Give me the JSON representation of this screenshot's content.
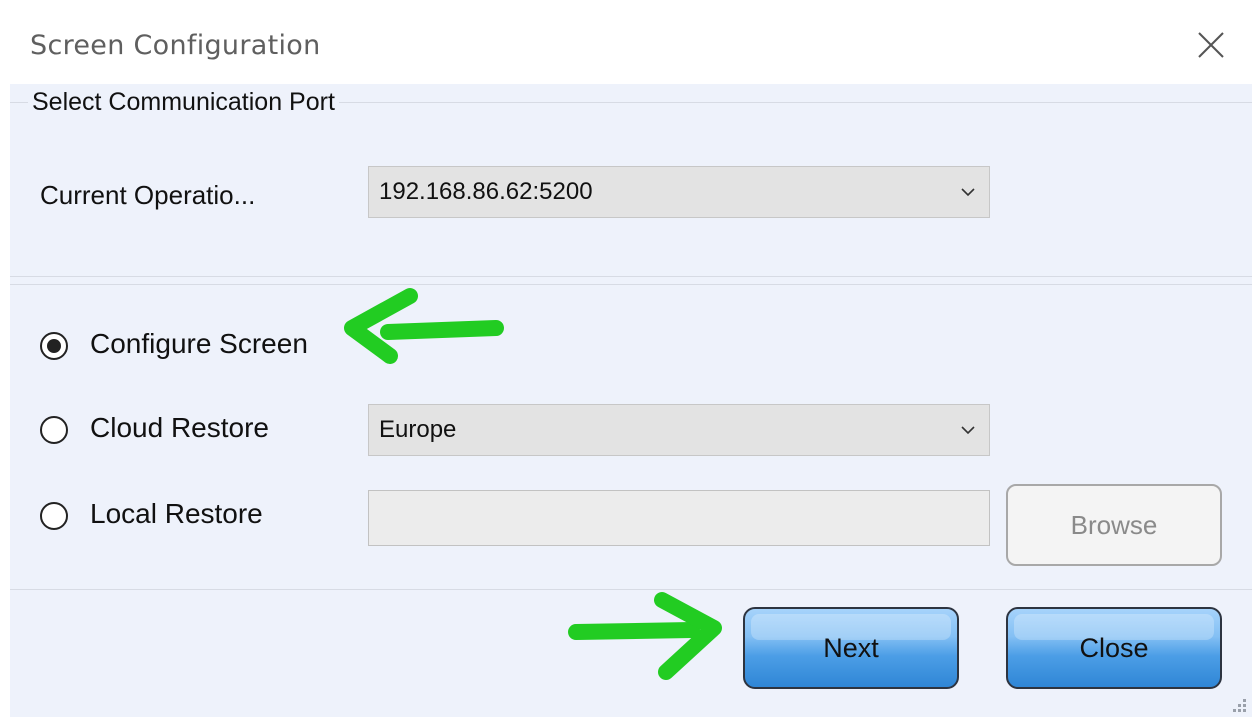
{
  "window": {
    "title": "Screen Configuration",
    "close_icon": "close-icon"
  },
  "port_group": {
    "legend": "Select Communication Port",
    "current_label": "Current Operatio...",
    "current_value": "192.168.86.62:5200"
  },
  "options": {
    "configure_label": "Configure Screen",
    "cloud_label": "Cloud Restore",
    "cloud_region": "Europe",
    "local_label": "Local Restore",
    "local_path": "",
    "browse_label": "Browse",
    "selected": "configure"
  },
  "footer": {
    "next_label": "Next",
    "close_label": "Close"
  },
  "annotations": {
    "arrow_color": "#22cc22",
    "arrow_icon": "green-arrow-icon"
  },
  "colors": {
    "client_bg": "#eef2fb",
    "primary_button": "#4c9ee6"
  }
}
